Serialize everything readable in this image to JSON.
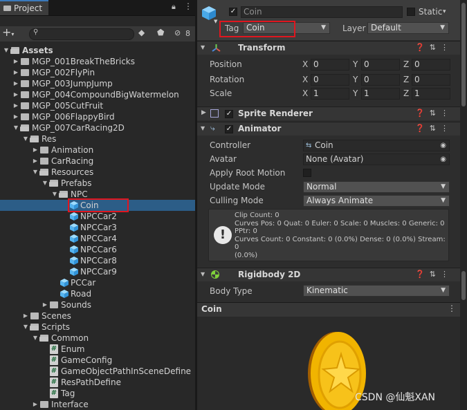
{
  "project": {
    "tab_label": "Project",
    "hidden_count": "8",
    "tree": [
      {
        "label": "Assets",
        "depth": 0,
        "type": "folder",
        "expanded": true,
        "bold": true
      },
      {
        "label": "MGP_001BreakTheBricks",
        "depth": 1,
        "type": "folder",
        "expanded": false
      },
      {
        "label": "MGP_002FlyPin",
        "depth": 1,
        "type": "folder",
        "expanded": false
      },
      {
        "label": "MGP_003JumpJump",
        "depth": 1,
        "type": "folder",
        "expanded": false
      },
      {
        "label": "MGP_004CompoundBigWatermelon",
        "depth": 1,
        "type": "folder",
        "expanded": false
      },
      {
        "label": "MGP_005CutFruit",
        "depth": 1,
        "type": "folder",
        "expanded": false
      },
      {
        "label": "MGP_006FlappyBird",
        "depth": 1,
        "type": "folder",
        "expanded": false
      },
      {
        "label": "MGP_007CarRacing2D",
        "depth": 1,
        "type": "folder",
        "expanded": true
      },
      {
        "label": "Res",
        "depth": 2,
        "type": "folder",
        "expanded": true
      },
      {
        "label": "Animation",
        "depth": 3,
        "type": "folder",
        "expanded": false
      },
      {
        "label": "CarRacing",
        "depth": 3,
        "type": "folder",
        "expanded": false
      },
      {
        "label": "Resources",
        "depth": 3,
        "type": "folder",
        "expanded": true
      },
      {
        "label": "Prefabs",
        "depth": 4,
        "type": "folder",
        "expanded": true
      },
      {
        "label": "NPC",
        "depth": 5,
        "type": "folder",
        "expanded": true
      },
      {
        "label": "Coin",
        "depth": 6,
        "type": "prefab",
        "selected": true
      },
      {
        "label": "NPCCar2",
        "depth": 6,
        "type": "prefab"
      },
      {
        "label": "NPCCar3",
        "depth": 6,
        "type": "prefab"
      },
      {
        "label": "NPCCar4",
        "depth": 6,
        "type": "prefab"
      },
      {
        "label": "NPCCar6",
        "depth": 6,
        "type": "prefab"
      },
      {
        "label": "NPCCar8",
        "depth": 6,
        "type": "prefab"
      },
      {
        "label": "NPCCar9",
        "depth": 6,
        "type": "prefab"
      },
      {
        "label": "PCCar",
        "depth": 5,
        "type": "prefab"
      },
      {
        "label": "Road",
        "depth": 5,
        "type": "prefab"
      },
      {
        "label": "Sounds",
        "depth": 4,
        "type": "folder",
        "expanded": false
      },
      {
        "label": "Scenes",
        "depth": 2,
        "type": "folder",
        "expanded": false
      },
      {
        "label": "Scripts",
        "depth": 2,
        "type": "folder",
        "expanded": true
      },
      {
        "label": "Common",
        "depth": 3,
        "type": "folder",
        "expanded": true
      },
      {
        "label": "Enum",
        "depth": 4,
        "type": "script"
      },
      {
        "label": "GameConfig",
        "depth": 4,
        "type": "script"
      },
      {
        "label": "GameObjectPathInSceneDefine",
        "depth": 4,
        "type": "script"
      },
      {
        "label": "ResPathDefine",
        "depth": 4,
        "type": "script"
      },
      {
        "label": "Tag",
        "depth": 4,
        "type": "script"
      },
      {
        "label": "Interface",
        "depth": 3,
        "type": "folder",
        "expanded": false
      }
    ]
  },
  "inspector": {
    "object_name": "Coin",
    "static_label": "Static",
    "tag_label": "Tag",
    "tag_value": "Coin",
    "layer_label": "Layer",
    "layer_value": "Default",
    "transform": {
      "title": "Transform",
      "position_label": "Position",
      "rotation_label": "Rotation",
      "scale_label": "Scale",
      "position": {
        "x": "0",
        "y": "0",
        "z": "0"
      },
      "rotation": {
        "x": "0",
        "y": "0",
        "z": "0"
      },
      "scale": {
        "x": "1",
        "y": "1",
        "z": "1"
      }
    },
    "sprite_renderer": {
      "title": "Sprite Renderer"
    },
    "animator": {
      "title": "Animator",
      "controller_label": "Controller",
      "controller_value": "Coin",
      "avatar_label": "Avatar",
      "avatar_value": "None (Avatar)",
      "apply_root_motion_label": "Apply Root Motion",
      "update_mode_label": "Update Mode",
      "update_mode_value": "Normal",
      "culling_mode_label": "Culling Mode",
      "culling_mode_value": "Always Animate",
      "info_lines": [
        "Clip Count: 0",
        "Curves Pos: 0 Quat: 0 Euler: 0 Scale: 0 Muscles: 0 Generic: 0",
        "PPtr: 0",
        "Curves Count: 0 Constant: 0 (0.0%) Dense: 0 (0.0%) Stream: 0",
        "(0.0%)"
      ]
    },
    "rigidbody": {
      "title": "Rigidbody 2D",
      "body_type_label": "Body Type",
      "body_type_value": "Kinematic"
    },
    "preview_title": "Coin"
  },
  "watermark": "CSDN @仙魁XAN",
  "colors": {
    "selection": "#2c5d87",
    "highlight_box": "#e0161f",
    "coin_gold": "#f1c40f",
    "accent_blue": "#3a79bb"
  }
}
